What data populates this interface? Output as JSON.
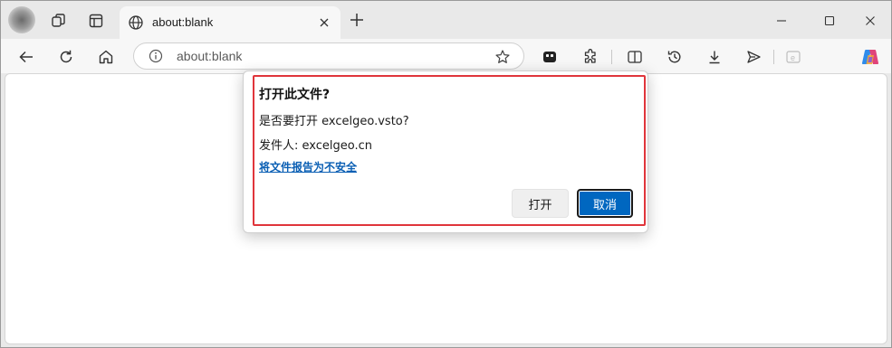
{
  "browser": {
    "tab": {
      "title": "about:blank",
      "icon": "globe-icon"
    },
    "address_bar": {
      "url_display": "about:blank"
    },
    "colors": {
      "accent": "#0067c0",
      "highlight_border": "#e0353b",
      "link": "#0a5fb4"
    }
  },
  "dialog": {
    "title": "打开此文件?",
    "question": "是否要打开 excelgeo.vsto?",
    "publisher": "发件人: excelgeo.cn",
    "report_link": "将文件报告为不安全",
    "open_button": "打开",
    "cancel_button": "取消"
  }
}
